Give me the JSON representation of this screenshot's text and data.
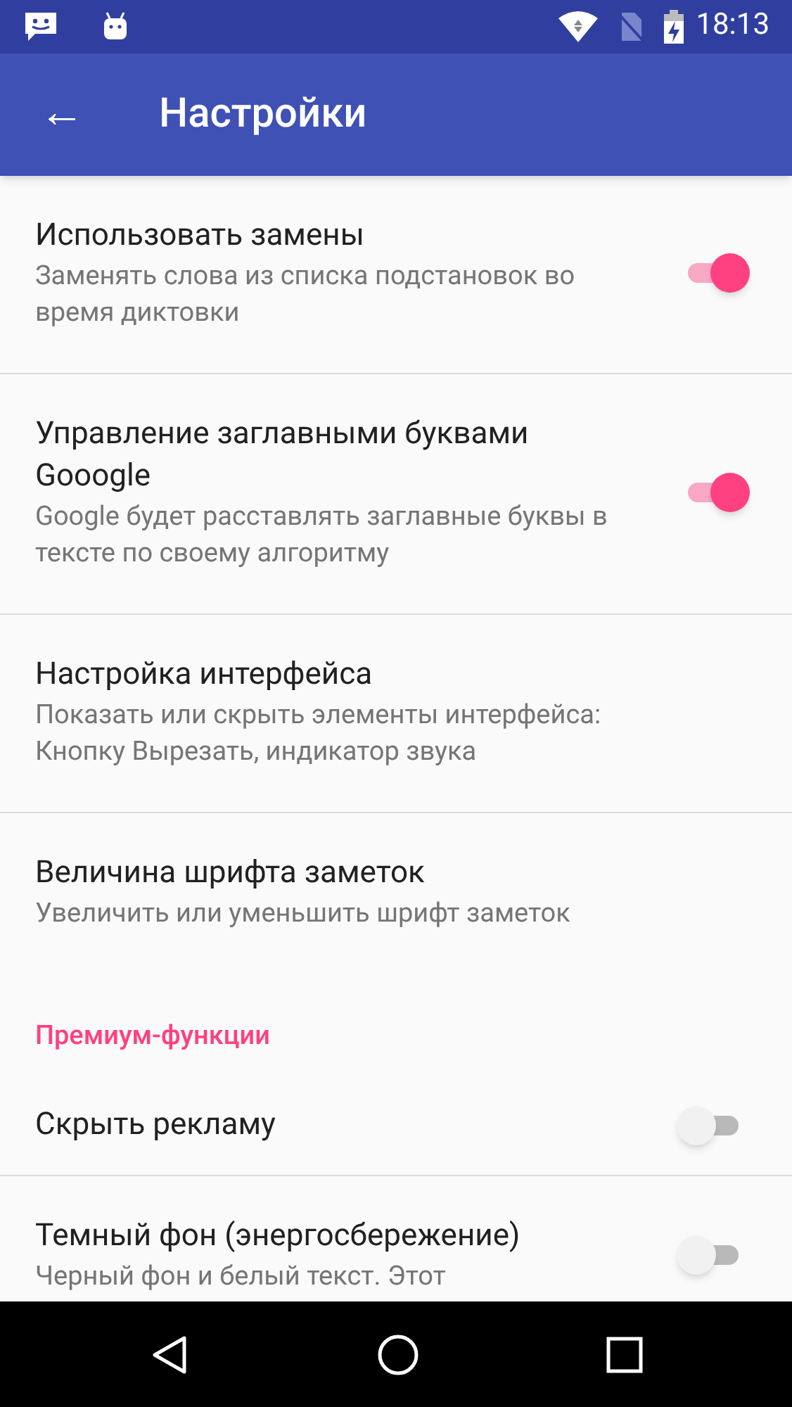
{
  "status_bar": {
    "time": "18:13"
  },
  "app_bar": {
    "back": "←",
    "title": "Настройки"
  },
  "settings": [
    {
      "kind": "setting",
      "title": "Использовать замены",
      "summary": "Заменять слова из списка подстановок во время диктовки",
      "on": true
    },
    {
      "kind": "divider"
    },
    {
      "kind": "setting",
      "title": "Управление заглавными буквами Gooogle",
      "summary": "Google будет расставлять заглавные буквы в тексте по своему алгоритму",
      "on": true
    },
    {
      "kind": "divider"
    },
    {
      "kind": "setting",
      "title": "Настройка интерфейса",
      "summary": "Показать или скрыть элементы интерфейса: Кнопку Вырезать, индикатор звука"
    },
    {
      "kind": "divider"
    },
    {
      "kind": "setting",
      "title": "Величина шрифта заметок",
      "summary": "Увеличить или уменьшить шрифт заметок"
    },
    {
      "kind": "header",
      "title": "Премиум-функции"
    },
    {
      "kind": "setting",
      "title": "Скрыть рекламу",
      "on": false
    },
    {
      "kind": "divider"
    },
    {
      "kind": "setting",
      "title": "Темный фон (энергосбережение)",
      "summary": "Черный фон и белый текст. Этот",
      "on": false
    }
  ]
}
